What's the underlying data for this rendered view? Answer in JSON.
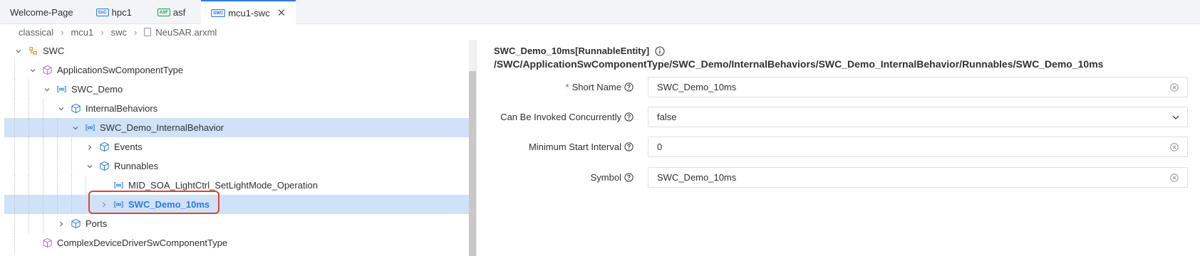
{
  "tabs": [
    {
      "label": "Welcome-Page",
      "badge": ""
    },
    {
      "label": "hpc1",
      "badge": "SoC"
    },
    {
      "label": "asf",
      "badge": "ASF"
    },
    {
      "label": "mcu1-swc",
      "badge": "SWC"
    }
  ],
  "breadcrumb": [
    "classical",
    "mcu1",
    "swc",
    "NeuSAR.arxml"
  ],
  "tree": [
    {
      "label": "SWC",
      "icon": "swc-folder-icon"
    },
    {
      "label": "ApplicationSwComponentType",
      "icon": "cube-icon"
    },
    {
      "label": "SWC_Demo",
      "icon": "component-icon"
    },
    {
      "label": "InternalBehaviors",
      "icon": "cube-icon"
    },
    {
      "label": "SWC_Demo_InternalBehavior",
      "icon": "component-icon"
    },
    {
      "label": "Events",
      "icon": "cube-icon"
    },
    {
      "label": "Runnables",
      "icon": "cube-icon"
    },
    {
      "label": "MID_SOA_LightCtrl_SetLightMode_Operation",
      "icon": "component-icon"
    },
    {
      "label": "SWC_Demo_10ms",
      "icon": "component-icon"
    },
    {
      "label": "Ports",
      "icon": "cube-icon"
    },
    {
      "label": "ComplexDeviceDriverSwComponentType",
      "icon": "cube-icon"
    }
  ],
  "detail": {
    "title": "SWC_Demo_10ms[RunnableEntity]",
    "path": "/SWC/ApplicationSwComponentType/SWC_Demo/InternalBehaviors/SWC_Demo_InternalBehavior/Runnables/SWC_Demo_10ms",
    "fields": [
      {
        "label": "Short Name",
        "required": "*",
        "value": "SWC_Demo_10ms"
      },
      {
        "label": "Can Be Invoked Concurrently",
        "value": "false"
      },
      {
        "label": "Minimum Start Interval",
        "value": "0"
      },
      {
        "label": "Symbol",
        "value": "SWC_Demo_10ms"
      }
    ]
  },
  "colors": {
    "accent": "#2d7be5",
    "selected_row": "#cfe2f7",
    "highlight_box": "#e0423a"
  }
}
